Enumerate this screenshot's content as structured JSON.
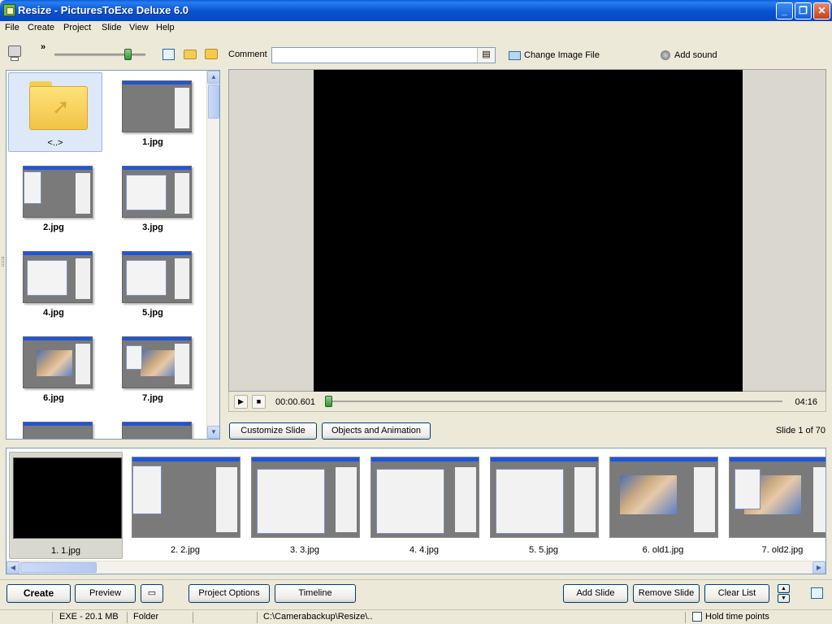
{
  "window": {
    "title": "Resize - PicturesToExe Deluxe 6.0"
  },
  "menu": [
    "File",
    "Create",
    "Project",
    "Slide",
    "View",
    "Help"
  ],
  "toolbar": {
    "overflow_label": "»"
  },
  "comment": {
    "label": "Comment",
    "value": "",
    "placeholder": ""
  },
  "change_image": {
    "label": "Change Image File"
  },
  "add_sound": {
    "label": "Add sound"
  },
  "browser": {
    "items": [
      {
        "label": "<..>",
        "kind": "folder-up"
      },
      {
        "label": "1.jpg",
        "kind": "blank"
      },
      {
        "label": "2.jpg",
        "kind": "dialog"
      },
      {
        "label": "3.jpg",
        "kind": "dialog"
      },
      {
        "label": "4.jpg",
        "kind": "dialog"
      },
      {
        "label": "5.jpg",
        "kind": "dialog"
      },
      {
        "label": "6.jpg",
        "kind": "photo"
      },
      {
        "label": "7.jpg",
        "kind": "photo"
      }
    ]
  },
  "player": {
    "current_time": "00:00.601",
    "total_time": "04:16",
    "position_fraction": 0.0
  },
  "slide_buttons": {
    "customize": "Customize Slide",
    "objects": "Objects and Animation"
  },
  "slide_counter": "Slide 1 of 70",
  "slides": [
    {
      "label": "1. 1.jpg",
      "kind": "black"
    },
    {
      "label": "2. 2.jpg",
      "kind": "dialog"
    },
    {
      "label": "3. 3.jpg",
      "kind": "dialog"
    },
    {
      "label": "4. 4.jpg",
      "kind": "dialog"
    },
    {
      "label": "5. 5.jpg",
      "kind": "dialog"
    },
    {
      "label": "6. old1.jpg",
      "kind": "photo"
    },
    {
      "label": "7. old2.jpg",
      "kind": "photo"
    }
  ],
  "bottom": {
    "create": "Create",
    "preview": "Preview",
    "project_options": "Project Options",
    "timeline": "Timeline",
    "add_slide": "Add Slide",
    "remove_slide": "Remove Slide",
    "clear_list": "Clear List"
  },
  "status": {
    "exe_size": "EXE - 20.1 MB",
    "mode": "Folder",
    "path": "C:\\Camerabackup\\Resize\\..",
    "hold_time_points": "Hold time points"
  },
  "colors": {
    "accent": "#0a55d0",
    "preview_bg": "#000000",
    "slider_green": "#2e9a2e"
  }
}
